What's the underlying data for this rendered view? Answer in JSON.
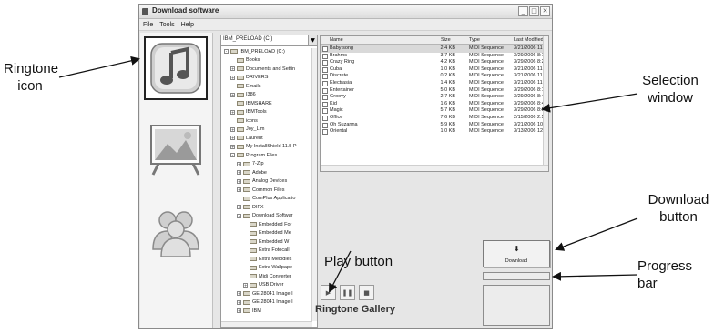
{
  "window": {
    "title": "Download software",
    "controls": [
      "_",
      "□",
      "✕"
    ]
  },
  "menubar": {
    "items": [
      "File",
      "Tools",
      "Help"
    ]
  },
  "iconstrip": {
    "icons": [
      {
        "icon": "music-note-icon",
        "selected": true
      },
      {
        "icon": "landscape-picture-icon",
        "selected": false
      },
      {
        "icon": "people-icon",
        "selected": false
      }
    ]
  },
  "tree": {
    "drive": "IBM_PRELOAD (C:)",
    "nodes": [
      {
        "label": "IBM_PRELOAD (C:)",
        "level": 0,
        "exp": "-"
      },
      {
        "label": "Books",
        "level": 1,
        "exp": ""
      },
      {
        "label": "Documents and Settin",
        "level": 1,
        "exp": "+"
      },
      {
        "label": "DRIVERS",
        "level": 1,
        "exp": "+"
      },
      {
        "label": "Emails",
        "level": 1,
        "exp": ""
      },
      {
        "label": "I386",
        "level": 1,
        "exp": "+"
      },
      {
        "label": "IBMSHARE",
        "level": 1,
        "exp": ""
      },
      {
        "label": "IBMTools",
        "level": 1,
        "exp": "+"
      },
      {
        "label": "icons",
        "level": 1,
        "exp": ""
      },
      {
        "label": "Joy_Lim",
        "level": 1,
        "exp": "+"
      },
      {
        "label": "Laurent",
        "level": 1,
        "exp": "+"
      },
      {
        "label": "My InstallShield 11.5 P",
        "level": 1,
        "exp": "+"
      },
      {
        "label": "Program Files",
        "level": 1,
        "exp": "-"
      },
      {
        "label": "7-Zip",
        "level": 2,
        "exp": "+"
      },
      {
        "label": "Adobe",
        "level": 2,
        "exp": "+"
      },
      {
        "label": "Analog Devices",
        "level": 2,
        "exp": "+"
      },
      {
        "label": "Common Files",
        "level": 2,
        "exp": "+"
      },
      {
        "label": "ComPlus Applicatio",
        "level": 2,
        "exp": ""
      },
      {
        "label": "DIFX",
        "level": 2,
        "exp": "+"
      },
      {
        "label": "Download Softwar",
        "level": 2,
        "exp": "-"
      },
      {
        "label": "Embedded For",
        "level": 3,
        "exp": ""
      },
      {
        "label": "Embedded Me",
        "level": 3,
        "exp": ""
      },
      {
        "label": "Embedded W",
        "level": 3,
        "exp": ""
      },
      {
        "label": "Extra Fotocall",
        "level": 3,
        "exp": ""
      },
      {
        "label": "Extra Melodies",
        "level": 3,
        "exp": ""
      },
      {
        "label": "Extra Wallpape",
        "level": 3,
        "exp": ""
      },
      {
        "label": "Midi Converter",
        "level": 3,
        "exp": ""
      },
      {
        "label": "USB Driver",
        "level": 3,
        "exp": "+"
      },
      {
        "label": "GE 28041 Image I",
        "level": 2,
        "exp": "+"
      },
      {
        "label": "GE 28041 Image I",
        "level": 2,
        "exp": "+"
      },
      {
        "label": "IBM",
        "level": 2,
        "exp": "+"
      }
    ]
  },
  "filelist": {
    "columns": [
      "Name",
      "Size",
      "Type",
      "Last Modified"
    ],
    "rows": [
      {
        "name": "Baby song",
        "size": "2.4 KB",
        "type": "MIDI Sequence",
        "modified": "3/21/2006 11",
        "selected": true
      },
      {
        "name": "Brahms",
        "size": "3.7 KB",
        "type": "MIDI Sequence",
        "modified": "3/29/2006 8:1",
        "selected": false
      },
      {
        "name": "Crazy Ring",
        "size": "4.2 KB",
        "type": "MIDI Sequence",
        "modified": "3/29/2006 8:2",
        "selected": false
      },
      {
        "name": "Cuba",
        "size": "1.0 KB",
        "type": "MIDI Sequence",
        "modified": "3/21/2006 11",
        "selected": false
      },
      {
        "name": "Discrete",
        "size": "0.2 KB",
        "type": "MIDI Sequence",
        "modified": "3/21/2006 11",
        "selected": false
      },
      {
        "name": "Electrasia",
        "size": "1.4 KB",
        "type": "MIDI Sequence",
        "modified": "3/21/2006 11",
        "selected": false
      },
      {
        "name": "Entertainer",
        "size": "5.0 KB",
        "type": "MIDI Sequence",
        "modified": "3/29/2006 8:1",
        "selected": false
      },
      {
        "name": "Groovy",
        "size": "2.7 KB",
        "type": "MIDI Sequence",
        "modified": "3/29/2006 8:4",
        "selected": false
      },
      {
        "name": "Kid",
        "size": "1.6 KB",
        "type": "MIDI Sequence",
        "modified": "3/29/2006 8:4",
        "selected": false
      },
      {
        "name": "Magic",
        "size": "5.7 KB",
        "type": "MIDI Sequence",
        "modified": "3/29/2006 8:5",
        "selected": false
      },
      {
        "name": "Office",
        "size": "7.6 KB",
        "type": "MIDI Sequence",
        "modified": "2/15/2006 2:5",
        "selected": false
      },
      {
        "name": "Oh Suzanna",
        "size": "5.9 KB",
        "type": "MIDI Sequence",
        "modified": "3/21/2006 10:",
        "selected": false
      },
      {
        "name": "Oriental",
        "size": "1.0 KB",
        "type": "MIDI Sequence",
        "modified": "3/13/2006 12:",
        "selected": false
      }
    ]
  },
  "transport": {
    "play": "▶",
    "pause": "❚❚",
    "stop": "■"
  },
  "gallery_title": "Ringtone Gallery",
  "download": {
    "arrow": "⬇",
    "label": "Download",
    "progress": 0.0
  },
  "callouts": {
    "ringtone_icon": [
      "Ringtone",
      "icon"
    ],
    "selection_window": [
      "Selection",
      "window"
    ],
    "download_button": [
      "Download",
      "button"
    ],
    "play_button": "Play button",
    "progress_bar": [
      "Progress",
      "bar"
    ]
  },
  "colors": {
    "accent": "#6a8fc7",
    "selected_row": "#d9d9d9",
    "window_bg": "#e6e6e6"
  }
}
